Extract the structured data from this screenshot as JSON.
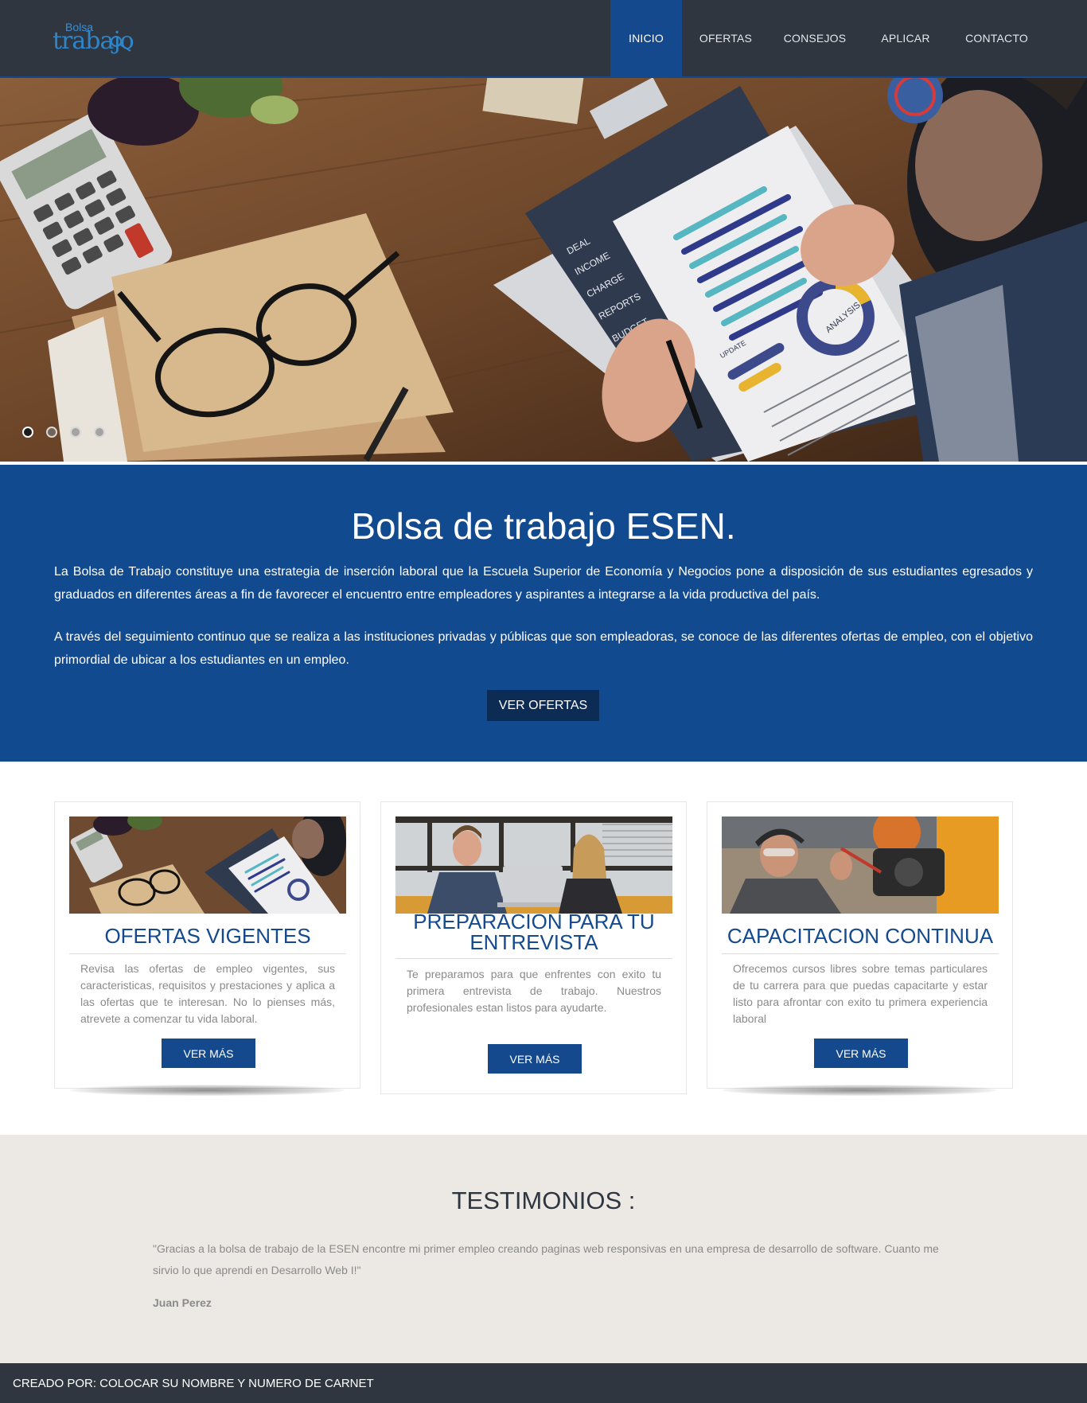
{
  "brand": {
    "logo_small": "Bolsa",
    "logo_big": "trabajo",
    "accent": "#14498d",
    "dark": "#2f3640"
  },
  "nav": {
    "items": [
      {
        "label": "INICIO",
        "active": true
      },
      {
        "label": "OFERTAS"
      },
      {
        "label": "CONSEJOS"
      },
      {
        "label": "APLICAR"
      },
      {
        "label": "CONTACTO"
      }
    ]
  },
  "hero": {
    "slides_count": 4,
    "active_slide": 1,
    "image_labels": {
      "deal": "DEAL",
      "income": "INCOME",
      "charge": "CHARGE",
      "reports": "REPORTS",
      "budget": "BUDGET",
      "analysis": "ANALYSIS",
      "update": "UPDATE"
    }
  },
  "intro": {
    "title": "Bolsa de trabajo ESEN.",
    "paragraph1": "La Bolsa de Trabajo constituye una estrategia de inserción laboral que la Escuela Superior de Economía y Negocios pone a disposición de sus estudiantes egresados y graduados en diferentes áreas a fin de favorecer el encuentro entre empleadores y aspirantes a integrarse a la vida productiva del país.",
    "paragraph2": "A través del seguimiento continuo que se realiza a las instituciones privadas y públicas que son empleadoras, se conoce de las diferentes ofertas de empleo, con el objetivo primordial de ubicar a los estudiantes en un empleo.",
    "button": "VER OFERTAS"
  },
  "cards": [
    {
      "title": "OFERTAS VIGENTES",
      "text": "Revisa las ofertas de empleo vigentes, sus caracteristicas, requisitos y prestaciones y aplica a las ofertas que te interesan. No lo pienses más, atrevete a comenzar tu vida laboral.",
      "button": "VER MÁS"
    },
    {
      "title": "PREPARACION PARA TU ENTREVISTA",
      "text": "Te preparamos para que enfrentes con exito tu primera entrevista de trabajo. Nuestros profesionales estan listos para ayudarte.",
      "button": "VER MÁS"
    },
    {
      "title": "CAPACITACION CONTINUA",
      "text": "Ofrecemos cursos libres sobre temas particulares de tu carrera para que puedas capacitarte y estar listo para afrontar con exito tu primera experiencia laboral",
      "button": "VER MÁS"
    }
  ],
  "testimonials": {
    "title": "TESTIMONIOS :",
    "quote": "\"Gracias a la bolsa de trabajo de la ESEN encontre mi primer empleo creando paginas web responsivas en una empresa de desarrollo de software. Cuanto me sirvio lo que aprendi en Desarrollo Web I!\"",
    "author": "Juan Perez"
  },
  "footer": {
    "text": "CREADO POR: COLOCAR SU NOMBRE Y NUMERO DE CARNET"
  }
}
